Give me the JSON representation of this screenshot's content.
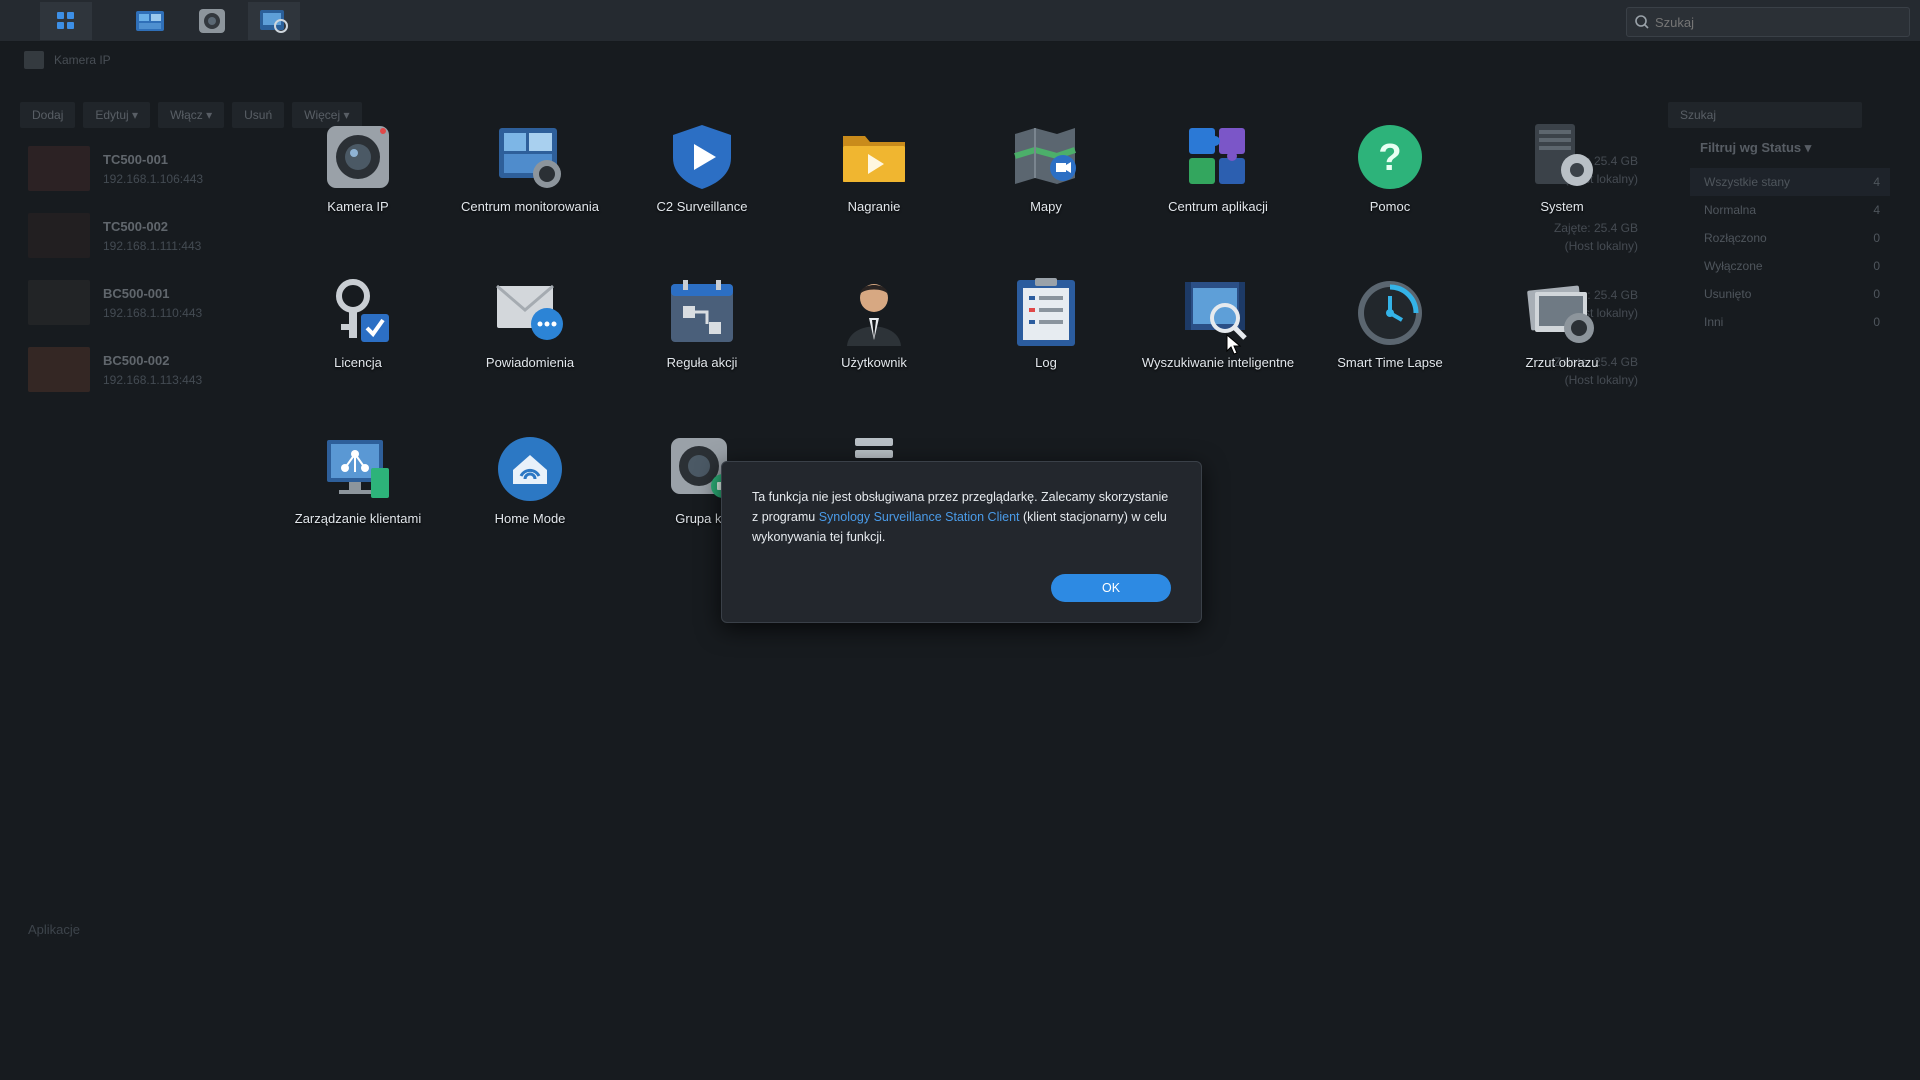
{
  "taskbar": {
    "search_placeholder": "Szukaj"
  },
  "background": {
    "window_title": "Kamera IP",
    "toolbar": [
      "Dodaj",
      "Edytuj ▾",
      "Włącz ▾",
      "Usuń",
      "Więcej ▾"
    ],
    "search_placeholder": "Szukaj",
    "cameras": [
      {
        "name": "TC500-001",
        "ip": "192.168.1.106:443"
      },
      {
        "name": "TC500-002",
        "ip": "192.168.1.111:443"
      },
      {
        "name": "BC500-001",
        "ip": "192.168.1.110:443"
      },
      {
        "name": "BC500-002",
        "ip": "192.168.1.113:443"
      }
    ],
    "cam_info": [
      "Zajęte: 25.4 GB",
      "(Host lokalny)"
    ],
    "filter": {
      "title": "Filtruj wg Status ▾",
      "items": [
        {
          "label": "Wszystkie stany",
          "count": "4"
        },
        {
          "label": "Normalna",
          "count": "4"
        },
        {
          "label": "Rozłączono",
          "count": "0"
        },
        {
          "label": "Wyłączone",
          "count": "0"
        },
        {
          "label": "Usunięto",
          "count": "0"
        },
        {
          "label": "Inni",
          "count": "0"
        }
      ]
    },
    "apps_section": "Aplikacje"
  },
  "launcher": {
    "apps": [
      {
        "label": "Kamera IP",
        "icon": "ip-camera-icon"
      },
      {
        "label": "Centrum monitorowania",
        "icon": "monitor-center-icon"
      },
      {
        "label": "C2 Surveillance",
        "icon": "c2-surveillance-icon"
      },
      {
        "label": "Nagranie",
        "icon": "recording-icon"
      },
      {
        "label": "Mapy",
        "icon": "map-icon"
      },
      {
        "label": "Centrum aplikacji",
        "icon": "app-center-icon"
      },
      {
        "label": "Pomoc",
        "icon": "help-icon"
      },
      {
        "label": "System",
        "icon": "system-icon"
      },
      {
        "label": "Licencja",
        "icon": "license-icon"
      },
      {
        "label": "Powiadomienia",
        "icon": "notification-icon"
      },
      {
        "label": "Reguła akcji",
        "icon": "action-rule-icon"
      },
      {
        "label": "Użytkownik",
        "icon": "user-icon"
      },
      {
        "label": "Log",
        "icon": "log-icon"
      },
      {
        "label": "Wyszukiwanie inteligentne",
        "icon": "smart-search-icon"
      },
      {
        "label": "Smart Time Lapse",
        "icon": "time-lapse-icon"
      },
      {
        "label": "Zrzut obrazu",
        "icon": "snapshot-icon"
      },
      {
        "label": "Zarządzanie klientami",
        "icon": "cms-icon"
      },
      {
        "label": "Home Mode",
        "icon": "home-mode-icon"
      },
      {
        "label": "Grupa ka",
        "icon": "camera-group-icon"
      }
    ]
  },
  "dialog": {
    "text_before": "Ta funkcja nie jest obsługiwana przez przeglądarkę. Zalecamy skorzystanie z programu ",
    "link": "Synology Surveillance Station Client",
    "text_after": " (klient stacjonarny) w celu wykonywania tej funkcji.",
    "ok_label": "OK"
  },
  "colors": {
    "accent": "#2d8ae3",
    "link": "#4a9be8"
  }
}
